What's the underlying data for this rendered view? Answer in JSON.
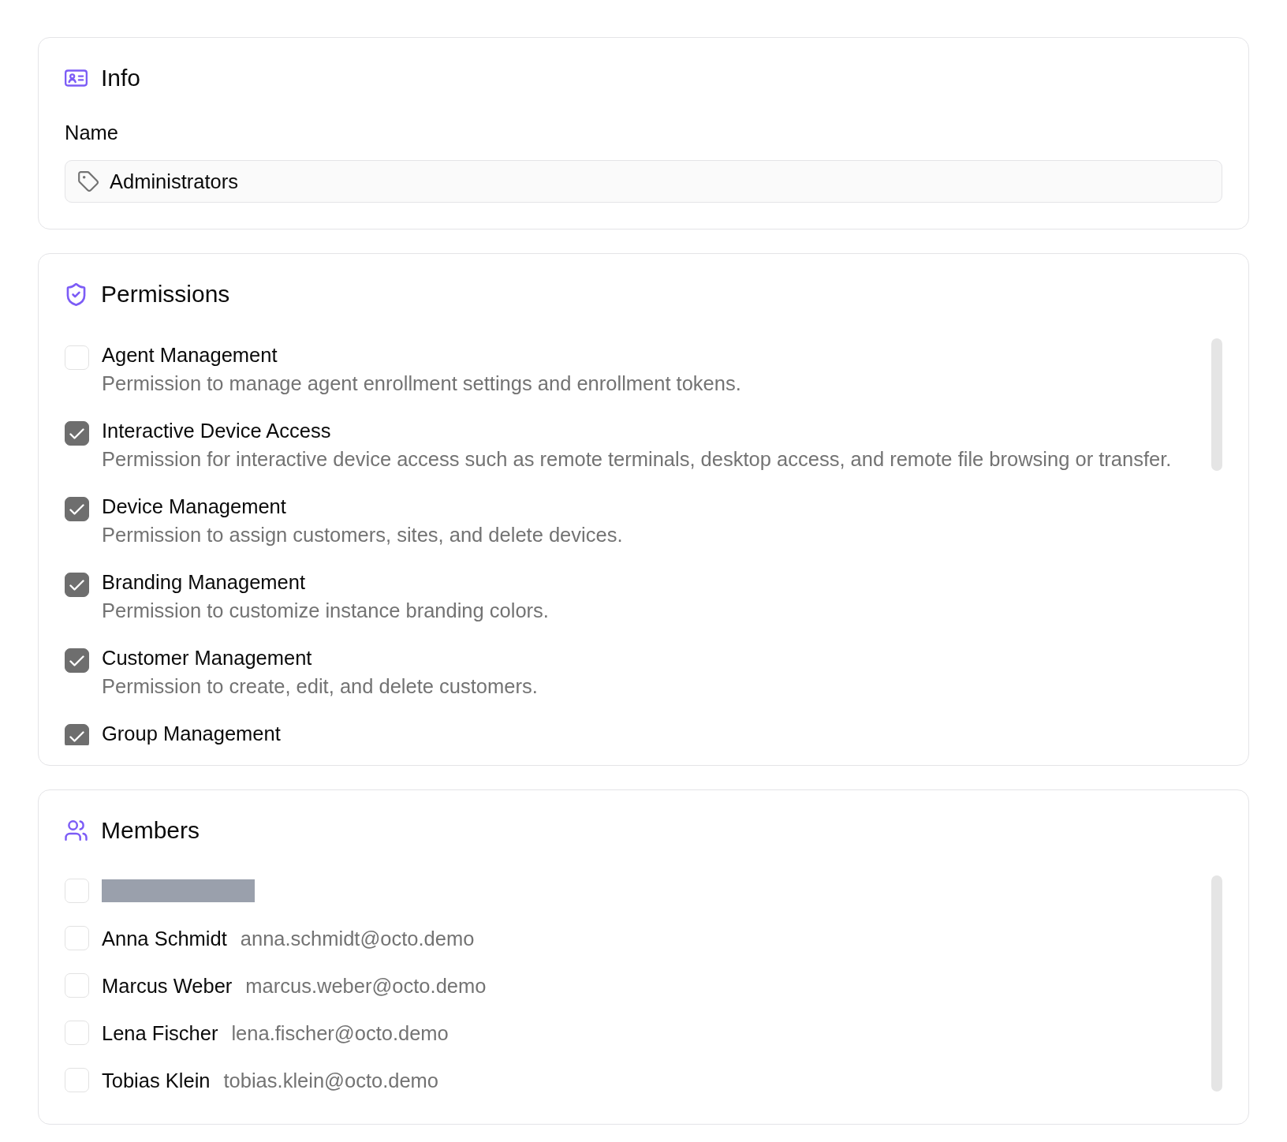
{
  "info": {
    "title": "Info",
    "name_field": {
      "label": "Name",
      "value": "Administrators"
    }
  },
  "permissions": {
    "title": "Permissions",
    "items": [
      {
        "label": "Agent Management",
        "description": "Permission to manage agent enrollment settings and enrollment tokens.",
        "checked": false
      },
      {
        "label": "Interactive Device Access",
        "description": "Permission for interactive device access such as remote terminals, desktop access, and remote file browsing or transfer.",
        "checked": true
      },
      {
        "label": "Device Management",
        "description": "Permission to assign customers, sites, and delete devices.",
        "checked": true
      },
      {
        "label": "Branding Management",
        "description": "Permission to customize instance branding colors.",
        "checked": true
      },
      {
        "label": "Customer Management",
        "description": "Permission to create, edit, and delete customers.",
        "checked": true
      },
      {
        "label": "Group Management",
        "checked": true
      }
    ]
  },
  "members": {
    "title": "Members",
    "items": [
      {
        "kind": "redacted",
        "checked": false
      },
      {
        "kind": "person",
        "name": "Anna Schmidt",
        "email": "anna.schmidt@octo.demo",
        "checked": false
      },
      {
        "kind": "person",
        "name": "Marcus Weber",
        "email": "marcus.weber@octo.demo",
        "checked": false
      },
      {
        "kind": "person",
        "name": "Lena Fischer",
        "email": "lena.fischer@octo.demo",
        "checked": false
      },
      {
        "kind": "person",
        "name": "Tobias Klein",
        "email": "tobias.klein@octo.demo",
        "checked": false
      }
    ]
  }
}
